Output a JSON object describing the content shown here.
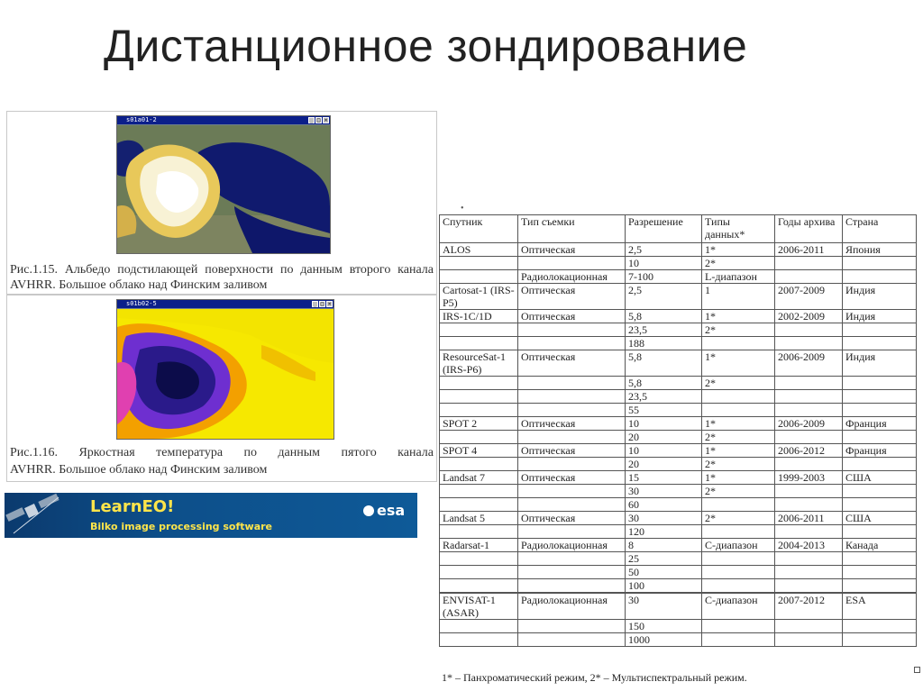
{
  "slide": {
    "title": "Дистанционное зондирование"
  },
  "figure1": {
    "window_title": "s01a01-2",
    "caption": [
      "Рис.1.15. Альбедо подстилающей поверхности по данным второго канала",
      "AVHRR. Большое облако над Финским заливом"
    ]
  },
  "figure2": {
    "window_title": "s01b02-5",
    "caption": [
      "Рис.1.16. Яркостная температура по данным пятого канала",
      "AVHRR. Большое облако над Финским заливом"
    ]
  },
  "banner": {
    "name": "LearnEO!",
    "subtitle": "Bilko image processing software",
    "logo": "esa"
  },
  "table": {
    "headers": [
      "Спутник",
      "Тип съемки",
      "Разрешение",
      "Типы данных*",
      "Годы архива",
      "Страна"
    ],
    "rows": [
      {
        "sat": "ALOS",
        "type": "Оптическая",
        "res": "2,5",
        "dtype": "1*",
        "years": "2006-2011",
        "country": "Япония"
      },
      {
        "sat": "",
        "type": "",
        "res": "10",
        "dtype": "2*",
        "years": "",
        "country": ""
      },
      {
        "sat": "",
        "type": "Радиолокационная",
        "res": "7-100",
        "dtype": "L-диапазон",
        "years": "",
        "country": ""
      },
      {
        "sat": "Cartosat-1 (IRS-P5)",
        "type": "Оптическая",
        "res": "2,5",
        "dtype": "1",
        "years": "2007-2009",
        "country": "Индия"
      },
      {
        "sat": "IRS-1C/1D",
        "type": "Оптическая",
        "res": "5,8",
        "dtype": "1*",
        "years": "2002-2009",
        "country": "Индия"
      },
      {
        "sat": "",
        "type": "",
        "res": "23,5",
        "dtype": "2*",
        "years": "",
        "country": ""
      },
      {
        "sat": "",
        "type": "",
        "res": "188",
        "dtype": "",
        "years": "",
        "country": ""
      },
      {
        "sat": "ResourceSat-1 (IRS-P6)",
        "type": "Оптическая",
        "res": "5,8",
        "dtype": "1*",
        "years": "2006-2009",
        "country": "Индия"
      },
      {
        "sat": "",
        "type": "",
        "res": "5,8",
        "dtype": "2*",
        "years": "",
        "country": ""
      },
      {
        "sat": "",
        "type": "",
        "res": "23,5",
        "dtype": "",
        "years": "",
        "country": ""
      },
      {
        "sat": "",
        "type": "",
        "res": "55",
        "dtype": "",
        "years": "",
        "country": ""
      },
      {
        "sat": "SPOT 2",
        "type": "Оптическая",
        "res": "10",
        "dtype": "1*",
        "years": "2006-2009",
        "country": "Франция"
      },
      {
        "sat": "",
        "type": "",
        "res": "20",
        "dtype": "2*",
        "years": "",
        "country": ""
      },
      {
        "sat": "SPOT 4",
        "type": "Оптическая",
        "res": "10",
        "dtype": "1*",
        "years": "2006-2012",
        "country": "Франция"
      },
      {
        "sat": "",
        "type": "",
        "res": "20",
        "dtype": "2*",
        "years": "",
        "country": ""
      },
      {
        "sat": "Landsat 7",
        "type": "Оптическая",
        "res": "15",
        "dtype": "1*",
        "years": "1999-2003",
        "country": "США"
      },
      {
        "sat": "",
        "type": "",
        "res": "30",
        "dtype": "2*",
        "years": "",
        "country": ""
      },
      {
        "sat": "",
        "type": "",
        "res": "60",
        "dtype": "",
        "years": "",
        "country": ""
      },
      {
        "sat": "Landsat 5",
        "type": "Оптическая",
        "res": "30",
        "dtype": "2*",
        "years": "2006-2011",
        "country": "США"
      },
      {
        "sat": "",
        "type": "",
        "res": "120",
        "dtype": "",
        "years": "",
        "country": ""
      },
      {
        "sat": "Radarsat-1",
        "type": "Радиолокационная",
        "res": "8",
        "dtype": "C-диапазон",
        "years": "2004-2013",
        "country": "Канада"
      },
      {
        "sat": "",
        "type": "",
        "res": "25",
        "dtype": "",
        "years": "",
        "country": ""
      },
      {
        "sat": "",
        "type": "",
        "res": "50",
        "dtype": "",
        "years": "",
        "country": ""
      },
      {
        "sat": "",
        "type": "",
        "res": "100",
        "dtype": "",
        "years": "",
        "country": ""
      },
      {
        "sat": "",
        "type": "",
        "res": "",
        "dtype": "",
        "years": "",
        "country": ""
      },
      {
        "sat": "ENVISAT-1 (ASAR)",
        "type": "Радиолокационная",
        "res": "30",
        "dtype": "C-диапазон",
        "years": "2007-2012",
        "country": "ESA"
      },
      {
        "sat": "",
        "type": "",
        "res": "150",
        "dtype": "",
        "years": "",
        "country": ""
      },
      {
        "sat": "",
        "type": "",
        "res": "1000",
        "dtype": "",
        "years": "",
        "country": ""
      }
    ],
    "footnote": "1* – Панхроматический режим, 2* – Мультиспектральный режим."
  }
}
